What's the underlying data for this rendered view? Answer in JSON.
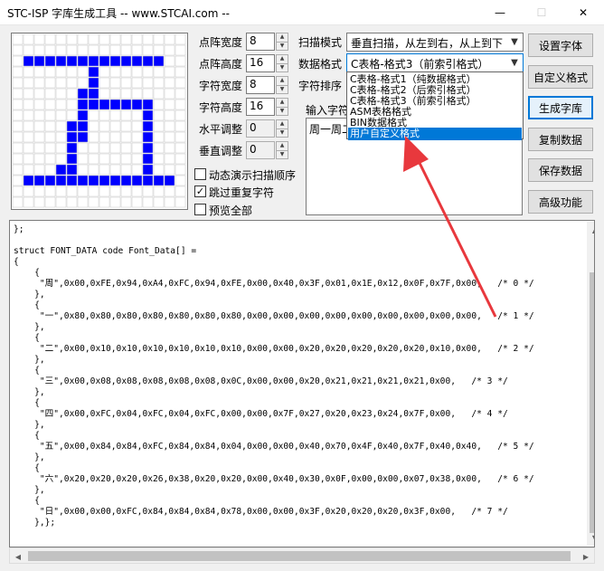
{
  "window": {
    "title": "STC-ISP 字库生成工具 -- www.STCAI.com --",
    "minimize_glyph": "—",
    "maximize_glyph": "☐",
    "close_glyph": "✕"
  },
  "font_preview": {
    "cols": 16,
    "rows": 16,
    "on_color": "#0000ff",
    "off_color": "#ffffff",
    "grid_color": "#c8c8c8",
    "pattern": [
      "0000000000000000",
      "0000000000000000",
      "0111111111111100",
      "0000000100000000",
      "0000000100000000",
      "0000001100000000",
      "0000001111111000",
      "0000001000001000",
      "0000011000001000",
      "0000011000001000",
      "0000010000001000",
      "0000010000001000",
      "0000110000001000",
      "0111111111111110",
      "0000000000000000",
      "0000000000000000"
    ]
  },
  "settings": {
    "dot_width": {
      "label": "点阵宽度",
      "value": "8"
    },
    "dot_height": {
      "label": "点阵高度",
      "value": "16"
    },
    "char_width": {
      "label": "字符宽度",
      "value": "8"
    },
    "char_height": {
      "label": "字符高度",
      "value": "16"
    },
    "h_adjust": {
      "label": "水平调整",
      "value": "0"
    },
    "v_adjust": {
      "label": "垂直调整",
      "value": "0"
    }
  },
  "checkboxes": {
    "animate_scan": {
      "label": "动态演示扫描顺序",
      "checked": false
    },
    "skip_duplicate": {
      "label": "跳过重复字符",
      "checked": true
    },
    "preview_all": {
      "label": "预览全部",
      "checked": false
    }
  },
  "scan_mode": {
    "label": "扫描模式",
    "value": "垂直扫描，从左到右，从上到下"
  },
  "data_format": {
    "label": "数据格式",
    "value": "C表格-格式3（前索引格式）",
    "options": [
      "C表格-格式1（纯数据格式）",
      "C表格-格式2（后索引格式）",
      "C表格-格式3（前索引格式）",
      "ASM表格格式",
      "BIN数据格式",
      "用户自定义格式"
    ],
    "selected_index": 5
  },
  "char_order": {
    "label": "字符排序"
  },
  "input_chars": {
    "label": "输入字符",
    "value": "周一周二"
  },
  "buttons": {
    "set_font": "设置字体",
    "custom_format": "自定义格式",
    "generate": "生成字库",
    "copy_data": "复制数据",
    "save_data": "保存数据",
    "advanced": "高级功能"
  },
  "code_lines": [
    "};",
    "",
    "struct FONT_DATA code Font_Data[] =",
    "{",
    "    {",
    "     \"周\",0x00,0xFE,0x94,0xA4,0xFC,0x94,0xFE,0x00,0x40,0x3F,0x01,0x1E,0x12,0x0F,0x7F,0x00,   /* 0 */",
    "    },",
    "    {",
    "     \"一\",0x80,0x80,0x80,0x80,0x80,0x80,0x80,0x00,0x00,0x00,0x00,0x00,0x00,0x00,0x00,0x00,   /* 1 */",
    "    },",
    "    {",
    "     \"二\",0x00,0x10,0x10,0x10,0x10,0x10,0x10,0x00,0x00,0x20,0x20,0x20,0x20,0x20,0x10,0x00,   /* 2 */",
    "    },",
    "    {",
    "     \"三\",0x00,0x08,0x08,0x08,0x08,0x08,0x0C,0x00,0x00,0x20,0x21,0x21,0x21,0x21,0x00,   /* 3 */",
    "    },",
    "    {",
    "     \"四\",0x00,0xFC,0x04,0xFC,0x04,0xFC,0x00,0x00,0x7F,0x27,0x20,0x23,0x24,0x7F,0x00,   /* 4 */",
    "    },",
    "    {",
    "     \"五\",0x00,0x84,0x84,0xFC,0x84,0x84,0x04,0x00,0x00,0x40,0x70,0x4F,0x40,0x7F,0x40,0x40,   /* 5 */",
    "    },",
    "    {",
    "     \"六\",0x20,0x20,0x20,0x26,0x38,0x20,0x20,0x00,0x40,0x30,0x0F,0x00,0x00,0x07,0x38,0x00,   /* 6 */",
    "    },",
    "    {",
    "     \"日\",0x00,0x00,0xFC,0x84,0x84,0x84,0x78,0x00,0x00,0x3F,0x20,0x20,0x20,0x3F,0x00,   /* 7 */",
    "    },};"
  ],
  "colors": {
    "accent": "#0078d7",
    "annotation_arrow": "#e8383d"
  }
}
